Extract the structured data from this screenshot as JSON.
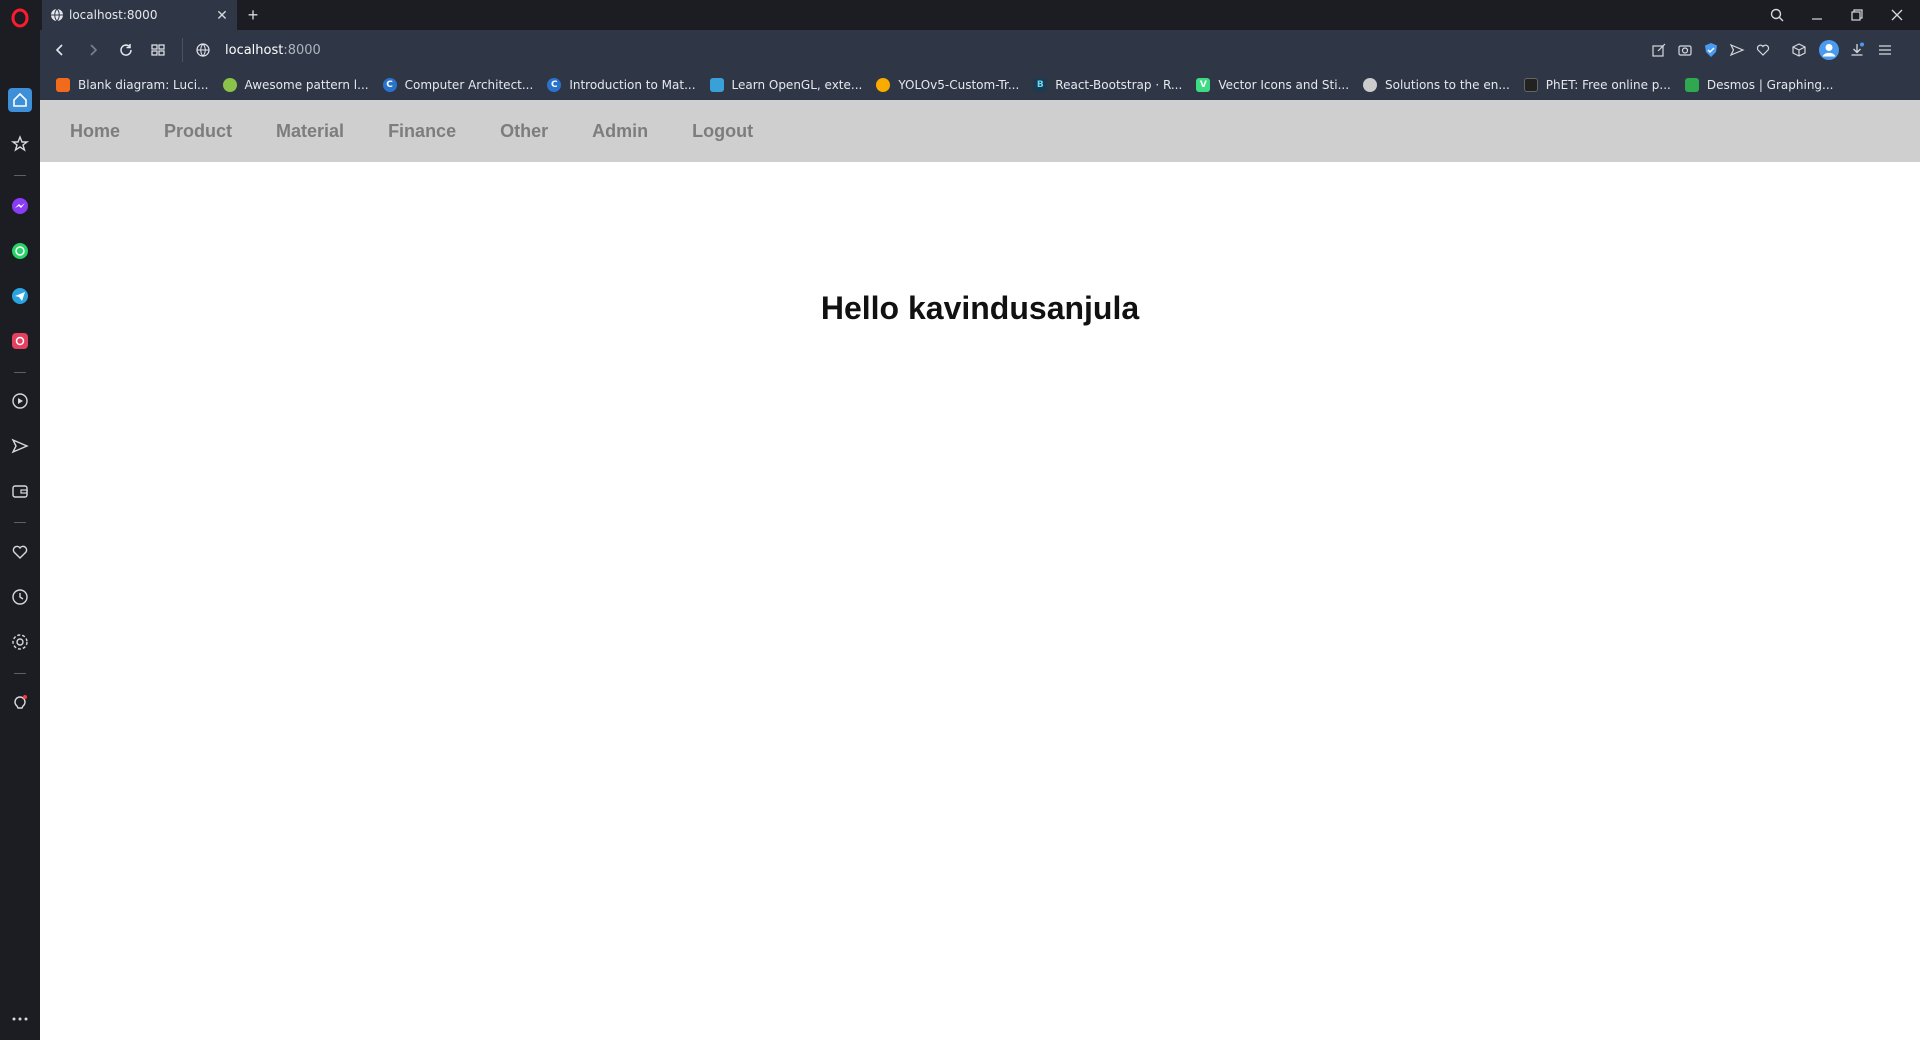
{
  "browser": {
    "tab": {
      "title": "localhost:8000"
    },
    "address": {
      "host": "localhost",
      "port": ":8000"
    },
    "bookmarks": [
      {
        "label": "Blank diagram: Luci...",
        "icon": "lucid-icon",
        "color": "#f26b1d"
      },
      {
        "label": "Awesome pattern l...",
        "icon": "android-icon",
        "color": "#8bc34a"
      },
      {
        "label": "Computer Architect...",
        "icon": "coursera-icon",
        "color": "#2a73cc"
      },
      {
        "label": "Introduction to Mat...",
        "icon": "coursera-icon",
        "color": "#2a73cc"
      },
      {
        "label": "Learn OpenGL, exte...",
        "icon": "opengl-icon",
        "color": "#3aa0d8"
      },
      {
        "label": "YOLOv5-Custom-Tr...",
        "icon": "colab-icon",
        "color": "#f9ab00"
      },
      {
        "label": "React-Bootstrap · R...",
        "icon": "react-bootstrap-icon",
        "color": "#61dafb"
      },
      {
        "label": "Vector Icons and Sti...",
        "icon": "vecteezy-icon",
        "color": "#3ddc84"
      },
      {
        "label": "Solutions to the en...",
        "icon": "solutions-icon",
        "color": "#cccccc"
      },
      {
        "label": "PhET: Free online p...",
        "icon": "phet-icon",
        "color": "#222222"
      },
      {
        "label": "Desmos | Graphing...",
        "icon": "desmos-icon",
        "color": "#2fa84f"
      }
    ]
  },
  "site": {
    "nav": [
      "Home",
      "Product",
      "Material",
      "Finance",
      "Other",
      "Admin",
      "Logout"
    ],
    "greeting": "Hello kavindusanjula"
  },
  "colors": {
    "sidebar_bg": "#1b1d22",
    "toolbar_bg": "#2f3746",
    "site_nav_bg": "#cfcfcf",
    "site_nav_text": "#7d7d7d"
  }
}
